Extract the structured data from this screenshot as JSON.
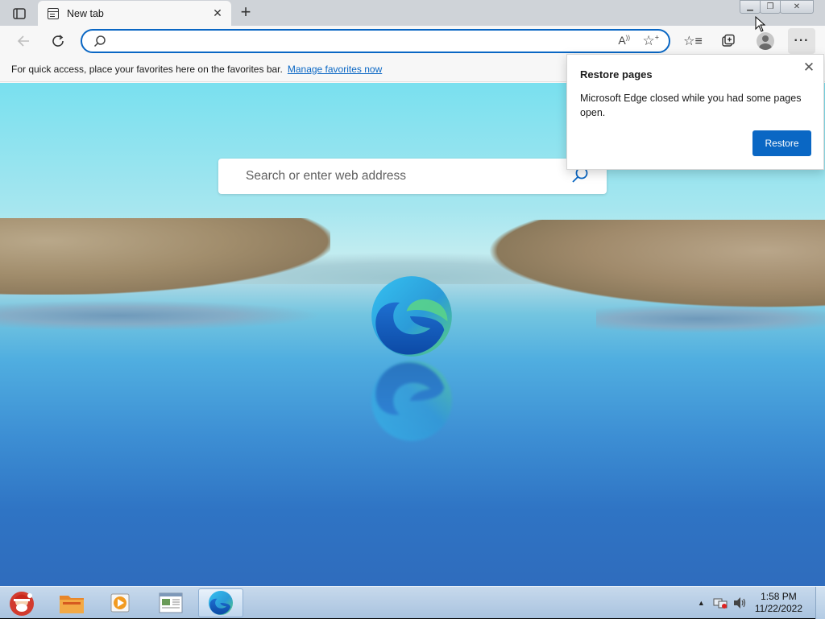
{
  "browser": {
    "tab": {
      "title": "New tab"
    },
    "omnibox": {
      "value": "",
      "placeholder": ""
    },
    "favorites_bar": {
      "message": "For quick access, place your favorites here on the favorites bar.",
      "link": "Manage favorites now"
    },
    "accent_color": "#0a67c4"
  },
  "newtab": {
    "search_placeholder": "Search or enter web address"
  },
  "restore_popup": {
    "title": "Restore pages",
    "body": "Microsoft Edge closed while you had some pages open.",
    "button": "Restore"
  },
  "taskbar": {
    "time": "1:58 PM",
    "date": "11/22/2022",
    "apps": [
      "start-orb",
      "file-explorer",
      "media-player",
      "document-viewer",
      "microsoft-edge"
    ]
  },
  "icons": {
    "tab_actions": "tab-actions-icon",
    "back": "back-arrow-icon",
    "refresh": "refresh-icon",
    "read_aloud": "read-aloud-icon",
    "add_favorite": "add-favorite-icon",
    "favorites": "favorites-icon",
    "collections": "collections-icon",
    "profile": "profile-icon",
    "more": "more-icon"
  }
}
